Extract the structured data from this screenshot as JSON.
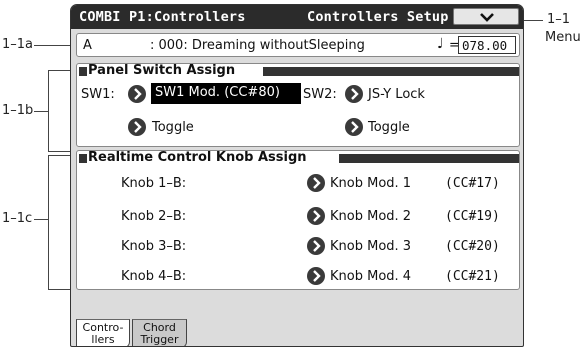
{
  "callouts": {
    "left_a": "1–1a",
    "left_b": "1–1b",
    "left_c": "1–1c",
    "right_num": "1–1",
    "right_label": "Menu"
  },
  "header": {
    "title_left": "COMBI P1:Controllers",
    "title_right": "Controllers Setup",
    "menu_icon": "chevron-down-icon"
  },
  "combi": {
    "bank": "A",
    "name": ": 000: Dreaming withoutSleeping",
    "tempo_icon": "♩",
    "tempo_eq": "=",
    "tempo_value": "078.00"
  },
  "panel_switch": {
    "title": "Panel Switch Assign",
    "sw1_label": "SW1:",
    "sw1_value": "SW1 Mod. (CC#80)",
    "sw1_mode": "Toggle",
    "sw2_label": "SW2:",
    "sw2_value": "JS-Y Lock",
    "sw2_mode": "Toggle"
  },
  "knobs": {
    "title": "Realtime Control Knob Assign",
    "rows": [
      {
        "label": "Knob 1–B:",
        "value": "Knob Mod. 1",
        "cc": "(CC#17)"
      },
      {
        "label": "Knob 2–B:",
        "value": "Knob Mod. 2",
        "cc": "(CC#19)"
      },
      {
        "label": "Knob 3–B:",
        "value": "Knob Mod. 3",
        "cc": "(CC#20)"
      },
      {
        "label": "Knob 4–B:",
        "value": "Knob Mod. 4",
        "cc": "(CC#21)"
      }
    ]
  },
  "tabs": [
    {
      "line1": "Contro-",
      "line2": "llers",
      "active": true
    },
    {
      "line1": "Chord",
      "line2": "Trigger",
      "active": false
    }
  ]
}
